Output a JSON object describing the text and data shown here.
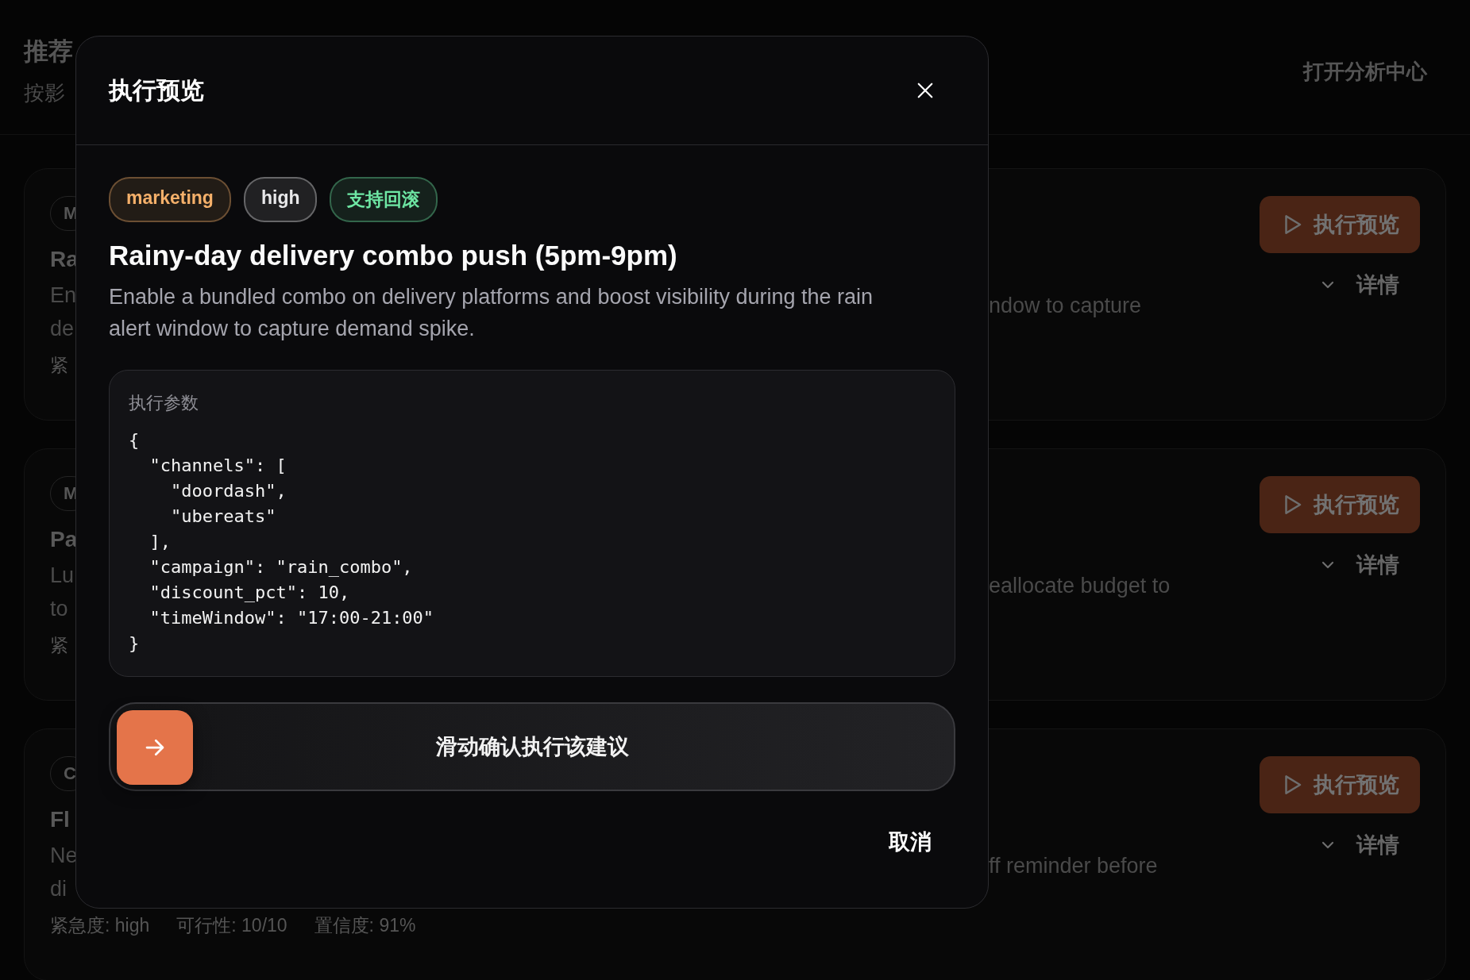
{
  "page": {
    "title": "推荐",
    "subtitle": "按影",
    "action": "打开分析中心"
  },
  "cards": [
    {
      "chip": "M",
      "title": "Ra",
      "description_lines": [
        "En",
        "de"
      ],
      "meta": [
        "紧"
      ],
      "description_tail": "ndow to capture",
      "preview_button": "执行预览",
      "details_button": "详情"
    },
    {
      "chip": "M",
      "title": "Pa",
      "description_lines": [
        "Lu",
        "to"
      ],
      "meta": [
        "紧"
      ],
      "description_tail": "eallocate budget to",
      "preview_button": "执行预览",
      "details_button": "详情"
    },
    {
      "chip": "C",
      "title": "Fl",
      "description_lines": [
        "Ne",
        "di"
      ],
      "meta": [
        "紧急度: high",
        "可行性: 10/10",
        "置信度: 91%"
      ],
      "description_tail": "ff reminder before",
      "preview_button": "执行预览",
      "details_button": "详情"
    }
  ],
  "modal": {
    "title": "执行预览",
    "tags": [
      {
        "label": "marketing",
        "color": "#f5b06a"
      },
      {
        "label": "high",
        "color": "#e8e8ea"
      },
      {
        "label": "支持回滚",
        "color": "#6ee7a4"
      }
    ],
    "heading": "Rainy-day delivery combo push (5pm-9pm)",
    "description": "Enable a bundled combo on delivery platforms and boost visibility during the rain alert window to capture demand spike.",
    "params": {
      "label": "执行参数",
      "code": "{\n  \"channels\": [\n    \"doordash\",\n    \"ubereats\"\n  ],\n  \"campaign\": \"rain_combo\",\n  \"discount_pct\": 10,\n  \"timeWindow\": \"17:00-21:00\"\n}"
    },
    "slider": {
      "label": "滑动确认执行该建议",
      "level": 0
    },
    "cancel": "取消"
  }
}
